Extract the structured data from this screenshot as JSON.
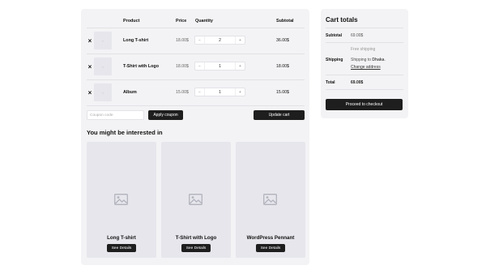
{
  "cart": {
    "headers": {
      "product": "Product",
      "price": "Price",
      "quantity": "Quantity",
      "subtotal": "Subtotal"
    },
    "items": [
      {
        "remove": "×",
        "thumb": "▫",
        "name": "Long T-shirt",
        "price": "18.00$",
        "qty": "2",
        "subtotal": "36.00$"
      },
      {
        "remove": "×",
        "thumb": "▫",
        "name": "T-Shirt with Logo",
        "price": "18.00$",
        "qty": "1",
        "subtotal": "18.00$"
      },
      {
        "remove": "×",
        "thumb": "▫",
        "name": "Album",
        "price": "15.00$",
        "qty": "1",
        "subtotal": "15.00$"
      }
    ],
    "qty_minus": "−",
    "qty_plus": "+",
    "coupon_placeholder": "Coupon code",
    "apply_coupon": "Apply coupon",
    "update_cart": "Update cart"
  },
  "cross_sells": {
    "title": "You might be interested in",
    "products": [
      {
        "name": "Long T-shirt",
        "button": "See Details"
      },
      {
        "name": "T-Shirt with Logo",
        "button": "See Details"
      },
      {
        "name": "WordPress Pennant",
        "button": "See Details"
      }
    ]
  },
  "totals": {
    "title": "Cart totals",
    "subtotal_label": "Subtotal",
    "subtotal_value": "69.00$",
    "shipping_label": "Shipping",
    "shipping_method": "Free shipping",
    "shipping_to_prefix": "Shipping to ",
    "shipping_to_city": "Dhaka",
    "shipping_to_suffix": ".",
    "change_address": "Change address",
    "total_label": "Total",
    "total_value": "69.00$",
    "checkout": "Proceed to checkout"
  },
  "colors": {
    "panel_bg": "#f3f3f5",
    "button_bg": "#1e1e1e",
    "placeholder_bg": "#e6e6ec"
  },
  "icons": {
    "remove": "close-icon",
    "placeholder": "image-placeholder-icon"
  }
}
